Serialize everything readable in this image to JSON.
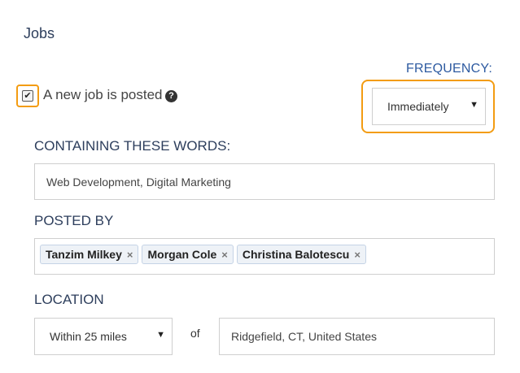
{
  "section": {
    "title": "Jobs"
  },
  "alert": {
    "checked": true,
    "checkmark": "✔",
    "label": "A new job is posted",
    "help_icon": "?"
  },
  "frequency": {
    "label": "FREQUENCY:",
    "selected": "Immediately",
    "arrow": "▼"
  },
  "keywords": {
    "label": "CONTAINING THESE WORDS:",
    "value": "Web Development, Digital Marketing"
  },
  "posted_by": {
    "label": "POSTED BY",
    "tags": [
      "Tanzim Milkey",
      "Morgan Cole",
      "Christina Balotescu"
    ],
    "remove_glyph": "×"
  },
  "location": {
    "label": "LOCATION",
    "radius": "Within 25 miles",
    "arrow": "▼",
    "of_label": "of",
    "place": "Ridgefield, CT, United States"
  },
  "colors": {
    "accent_outline": "#f39c12",
    "label_blue": "#2d5aa0",
    "heading": "#2d3e5c"
  }
}
